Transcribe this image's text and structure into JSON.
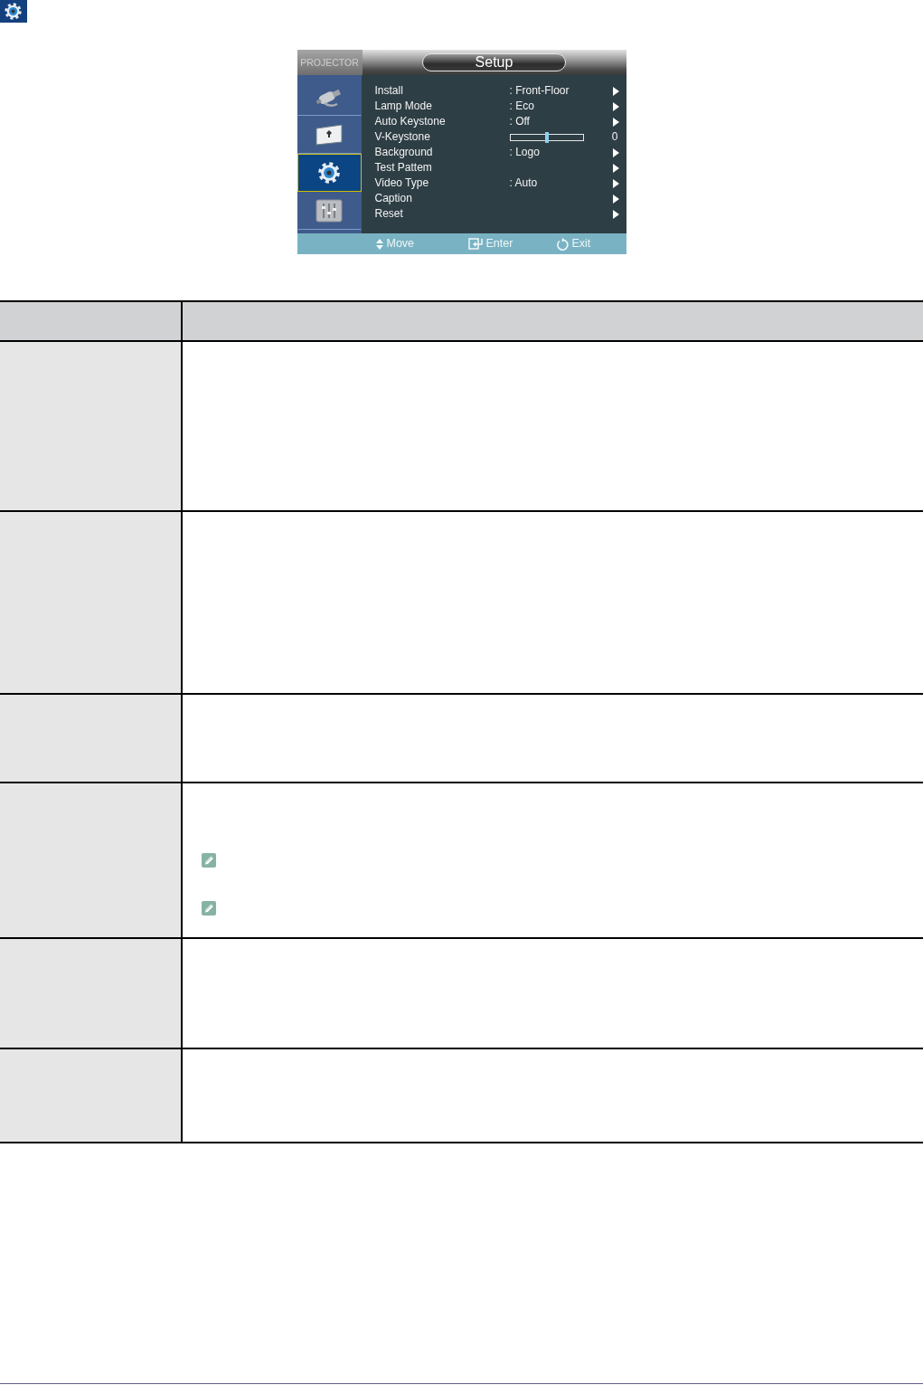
{
  "osd": {
    "brand": "PROJECTOR",
    "title": "Setup",
    "tabs": [
      {
        "selected": false
      },
      {
        "selected": false
      },
      {
        "selected": true
      },
      {
        "selected": false
      }
    ],
    "items": [
      {
        "kind": "option",
        "label": "Install",
        "value": ": Front-Floor"
      },
      {
        "kind": "option",
        "label": "Lamp Mode",
        "value": ": Eco"
      },
      {
        "kind": "option",
        "label": "Auto Keystone",
        "value": ": Off"
      },
      {
        "kind": "slider",
        "label": "V-Keystone",
        "level": 0.5,
        "reading": "0"
      },
      {
        "kind": "option",
        "label": "Background",
        "value": ": Logo"
      },
      {
        "kind": "option",
        "label": "Test Pattem"
      },
      {
        "kind": "option",
        "label": "Video Type",
        "value": ": Auto"
      },
      {
        "kind": "option",
        "label": "Caption"
      },
      {
        "kind": "option",
        "label": "Reset"
      }
    ],
    "hints": [
      {
        "label": "Move"
      },
      {
        "label": "Enter"
      },
      {
        "label": "Exit"
      }
    ]
  },
  "table": {
    "rows": [
      {
        "kind": "plain"
      },
      {
        "kind": "plain"
      },
      {
        "kind": "plain"
      },
      {
        "kind": "notes",
        "notes": [
          {
            "kind": "note"
          },
          {
            "kind": "note"
          }
        ]
      },
      {
        "kind": "plain"
      },
      {
        "kind": "plain"
      }
    ]
  }
}
